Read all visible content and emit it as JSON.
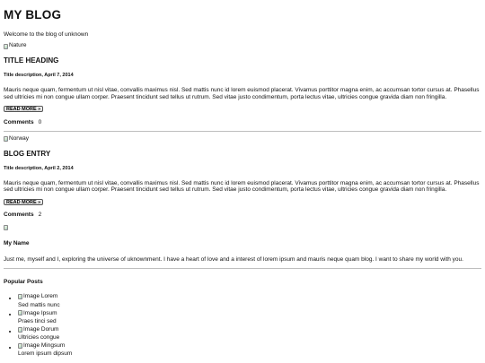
{
  "blog": {
    "title": "MY BLOG",
    "welcome": "Welcome to the blog of unknown"
  },
  "posts": [
    {
      "image_alt": "Nature",
      "heading": "TITLE HEADING",
      "description": "Title description, April 7, 2014",
      "body": "Mauris neque quam, fermentum ut nisl vitae, convallis maximus nisl. Sed mattis nunc id lorem euismod placerat. Vivamus porttitor magna enim, ac accumsan tortor cursus at. Phasellus sed ultricies mi non congue ullam corper. Praesent tincidunt sed tellus ut rutrum. Sed vitae justo condimentum, porta lectus vitae, ultricies congue gravida diam non fringilla.",
      "read_more": "READ MORE »",
      "comments_label": "Comments",
      "comments_count": "0"
    },
    {
      "image_alt": "Norway",
      "heading": "BLOG ENTRY",
      "description": "Title description, April 2, 2014",
      "body": "Mauris neque quam, fermentum ut nisl vitae, convallis maximus nisl. Sed mattis nunc id lorem euismod placerat. Vivamus porttitor magna enim, ac accumsan tortor cursus at. Phasellus sed ultricies mi non congue ullam corper. Praesent tincidunt sed tellus ut rutrum. Sed vitae justo condimentum, porta lectus vitae, ultricies congue gravida diam non fringilla.",
      "read_more": "READ MORE »",
      "comments_label": "Comments",
      "comments_count": "2"
    }
  ],
  "profile": {
    "name": "My Name",
    "bio": "Just me, myself and I, exploring the universe of uknownment. I have a heart of love and a interest of lorem ipsum and mauris neque quam blog. I want to share my world with you."
  },
  "popular": {
    "title": "Popular Posts",
    "items": [
      {
        "image_alt": "Image Lorem",
        "caption": "Sed mattis nunc"
      },
      {
        "image_alt": "Image Ipsum",
        "caption": "Praes tinci sed"
      },
      {
        "image_alt": "Image Dorum",
        "caption": "Ultricies congue"
      },
      {
        "image_alt": "Image Mingsum",
        "caption": "Lorem ipsum dipsum"
      }
    ]
  }
}
